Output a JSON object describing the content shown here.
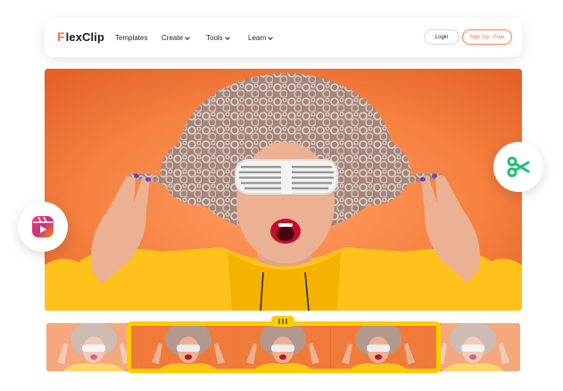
{
  "nav": {
    "logo_mark": "F",
    "logo_text": "lexClip",
    "items": [
      {
        "label": "Templates",
        "has_dropdown": false
      },
      {
        "label": "Create",
        "has_dropdown": true
      },
      {
        "label": "Tools",
        "has_dropdown": true
      },
      {
        "label": "Learn",
        "has_dropdown": true
      }
    ],
    "login_label": "Login",
    "signup_label": "Sign Up - Free"
  },
  "hero": {
    "icons": {
      "left": "reels-icon",
      "right": "scissors-icon"
    }
  },
  "timeline": {
    "frame_count": 5
  },
  "colors": {
    "accent": "#ff6b3d",
    "selection": "#ffcc00",
    "scissors": "#1fbf7a",
    "background_orange": "#f58140",
    "hoodie_yellow": "#ffc21a"
  }
}
